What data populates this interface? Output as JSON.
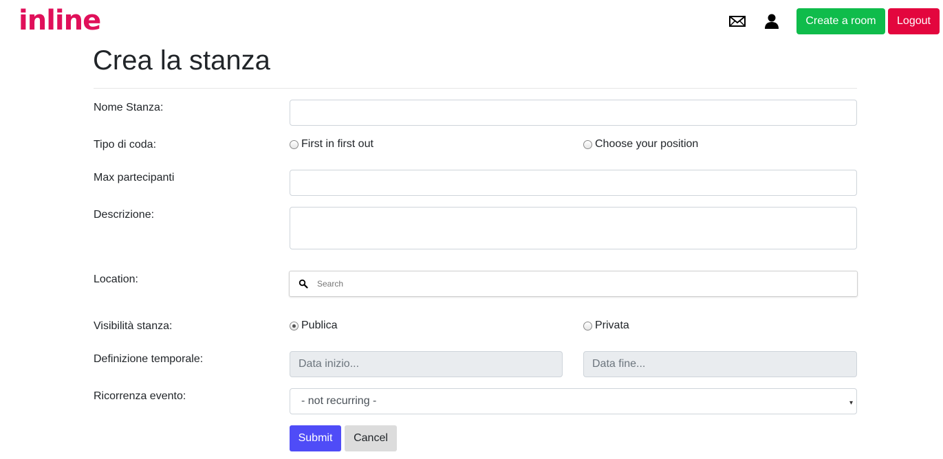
{
  "header": {
    "logo_text": "inline",
    "logo_color": "#e0105a",
    "icons": [
      "mail-icon",
      "user-icon"
    ],
    "create_room_label": "Create a room",
    "logout_label": "Logout",
    "create_room_color": "#0fbc4b",
    "logout_color": "#e3063e"
  },
  "page": {
    "title": "Crea la stanza"
  },
  "form": {
    "nome_stanza_label": "Nome Stanza:",
    "nome_stanza_value": "",
    "tipo_coda_label": "Tipo di coda:",
    "tipo_coda_options": [
      {
        "label": "First in first out",
        "checked": false
      },
      {
        "label": "Choose your position",
        "checked": false
      }
    ],
    "max_partecipanti_label": "Max partecipanti",
    "max_partecipanti_value": "",
    "descrizione_label": "Descrizione:",
    "descrizione_value": "",
    "location_label": "Location:",
    "location_placeholder": "Search",
    "visibilita_label": "Visibilità stanza:",
    "visibilita_options": [
      {
        "label": "Publica",
        "checked": true
      },
      {
        "label": "Privata",
        "checked": false
      }
    ],
    "definizione_label": "Definizione temporale:",
    "data_inizio_placeholder": "Data inizio...",
    "data_fine_placeholder": "Data fine...",
    "ricorrenza_label": "Ricorrenza evento:",
    "ricorrenza_selected": "- not recurring -",
    "submit_label": "Submit",
    "cancel_label": "Cancel",
    "submit_color": "#4f4cf7"
  }
}
